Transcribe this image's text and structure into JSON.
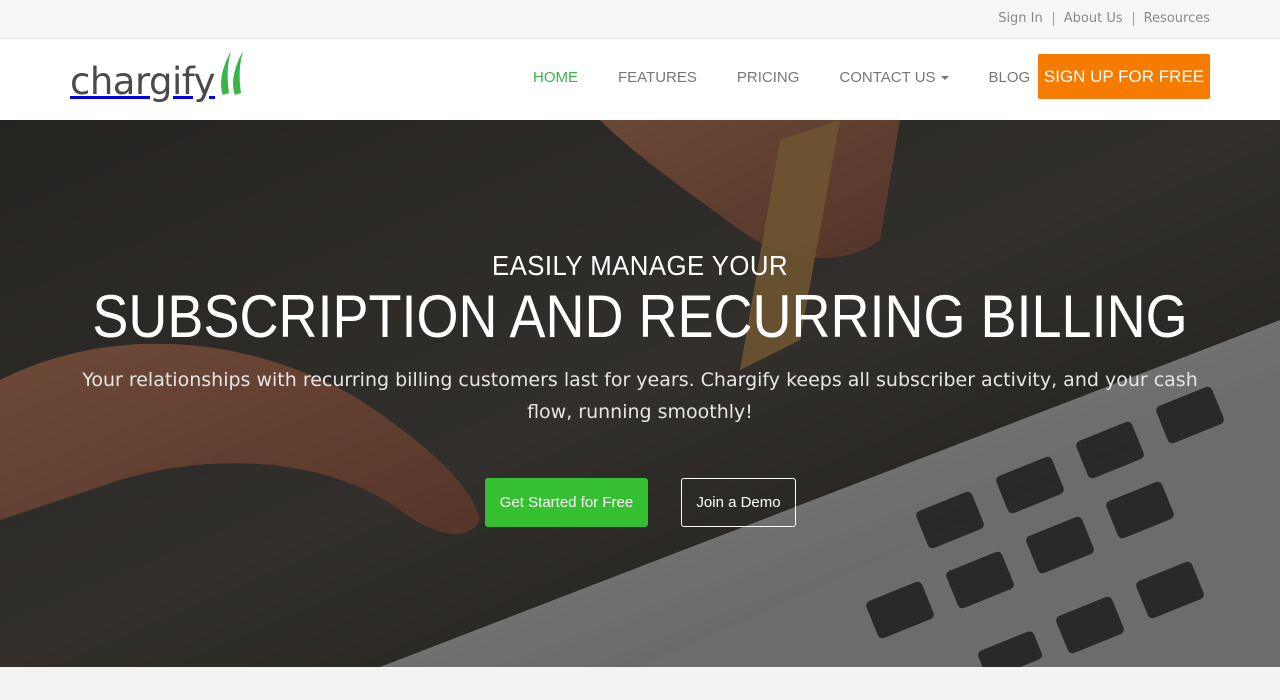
{
  "utility": {
    "links": [
      {
        "label": "Sign In"
      },
      {
        "label": "About Us"
      },
      {
        "label": "Resources"
      }
    ]
  },
  "brand": {
    "name": "chargify",
    "accent_color": "#39b54a",
    "logo_icon": "chargify-swoosh-icon"
  },
  "nav": {
    "items": [
      {
        "label": "HOME",
        "active": true
      },
      {
        "label": "FEATURES",
        "active": false
      },
      {
        "label": "PRICING",
        "active": false
      },
      {
        "label": "CONTACT US",
        "active": false,
        "dropdown": true
      },
      {
        "label": "BLOG",
        "active": false
      }
    ],
    "signup_label": "SIGN UP FOR FREE",
    "signup_color": "#f57c00"
  },
  "hero": {
    "kicker": "EASILY MANAGE YOUR",
    "title": "SUBSCRIPTION AND RECURRING BILLING",
    "subtitle": "Your relationships with recurring billing customers last for years. Chargify keeps all subscriber activity, and your cash flow, running smoothly!",
    "primary_cta": "Get Started for Free",
    "secondary_cta": "Join a Demo",
    "primary_color": "#35c032",
    "background_image": "hand-with-credit-card-over-laptop-keyboard"
  }
}
